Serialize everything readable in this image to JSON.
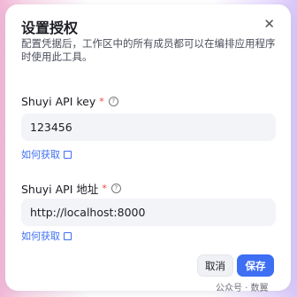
{
  "dialog": {
    "title": "设置授权",
    "close_symbol": "✕",
    "description": "配置凭据后，工作区中的所有成员都可以在编排应用程序时使用此工具。",
    "fields": [
      {
        "label": "Shuyi API key",
        "required_mark": "*",
        "help_symbol": "?",
        "value": "123456",
        "link": "如何获取"
      },
      {
        "label": "Shuyi API 地址",
        "required_mark": "*",
        "help_symbol": "?",
        "value": "http://localhost:8000",
        "link": "如何获取"
      }
    ],
    "cancel_label": "取消",
    "save_label": "保存"
  },
  "watermark": "公众号 · 数翼",
  "colors": {
    "accent": "#3d6ef3",
    "required": "#f0433a",
    "link": "#3e6ff1"
  }
}
